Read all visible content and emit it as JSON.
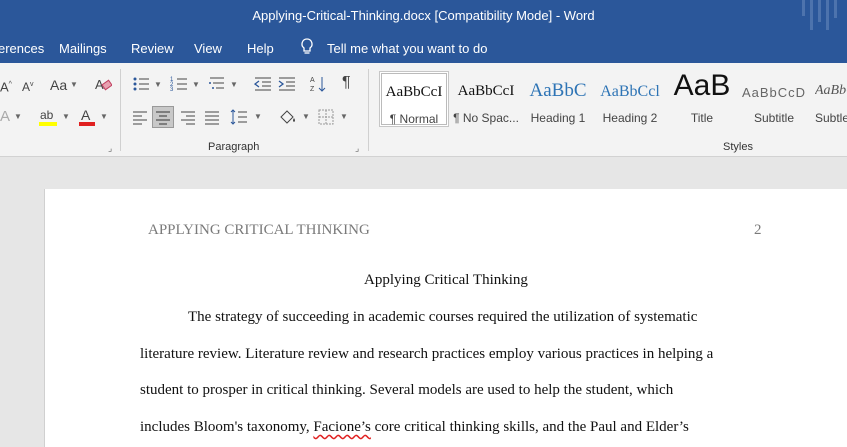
{
  "window": {
    "title": "Applying-Critical-Thinking.docx [Compatibility Mode]  -  Word"
  },
  "menu": {
    "items": [
      "erences",
      "Mailings",
      "Review",
      "View",
      "Help"
    ],
    "tell_me": "Tell me what you want to do"
  },
  "ribbon": {
    "paragraph_label": "Paragraph",
    "styles_label": "Styles",
    "font_size_glyph": "Aa",
    "styles": [
      {
        "preview": "AaBbCcI",
        "name": "¶ Normal"
      },
      {
        "preview": "AaBbCcI",
        "name": "¶ No Spac..."
      },
      {
        "preview": "AaBbC",
        "name": "Heading 1"
      },
      {
        "preview": "AaBbCcl",
        "name": "Heading 2"
      },
      {
        "preview": "AaB",
        "name": "Title"
      },
      {
        "preview": "AaBbCcD",
        "name": "Subtitle"
      },
      {
        "preview": "AaBbCcl",
        "name": "Subtle"
      }
    ]
  },
  "colors": {
    "titlebar": "#2b579a",
    "highlight": "#ffff00",
    "font_color": "#e02020"
  },
  "document": {
    "running_head": "APPLYING CRITICAL THINKING",
    "page_number": "2",
    "heading": "Applying Critical Thinking",
    "lines": [
      "The strategy of succeeding in academic courses required the utilization of systematic",
      "literature review. Literature review and research practices employ various practices in helping a",
      "student to prosper in critical thinking. Several models are used to help the student, which"
    ],
    "line4_before": "includes Bloom's taxonomy, ",
    "line4_misspelled": "Facione’s",
    "line4_after": " core critical thinking skills, and the Paul and Elder’s"
  }
}
